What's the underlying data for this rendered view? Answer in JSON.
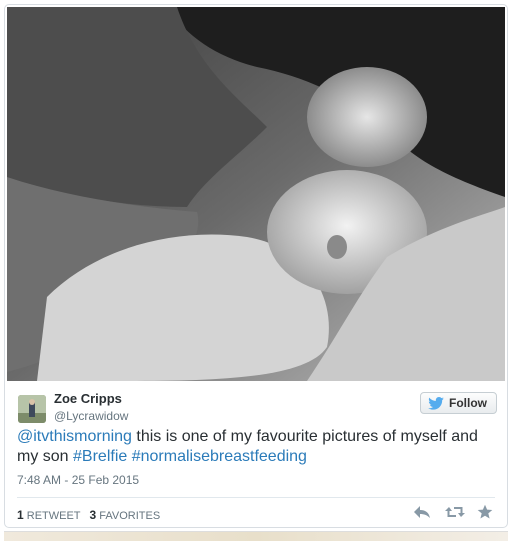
{
  "tweet": {
    "author_name": "Zoe Cripps",
    "author_handle": "@Lycrawidow",
    "follow_label": "Follow",
    "text_mention": "@itvthismorning",
    "text_body": " this is one of my favourite pictures of myself and my son ",
    "hashtag_1": "#Brelfie",
    "hashtag_2": "#normalisebreastfeeding",
    "timestamp": "7:48 AM - 25 Feb 2015",
    "retweet_count": "1",
    "retweet_label": "RETWEET",
    "favorite_count": "3",
    "favorite_label": "FAVORITES"
  },
  "icons": {
    "follow": "twitter-bird-icon",
    "reply": "reply-icon",
    "retweet": "retweet-icon",
    "favorite": "star-icon"
  },
  "colors": {
    "link": "#2b7bb9",
    "text": "#292f33",
    "muted": "#66757f"
  }
}
